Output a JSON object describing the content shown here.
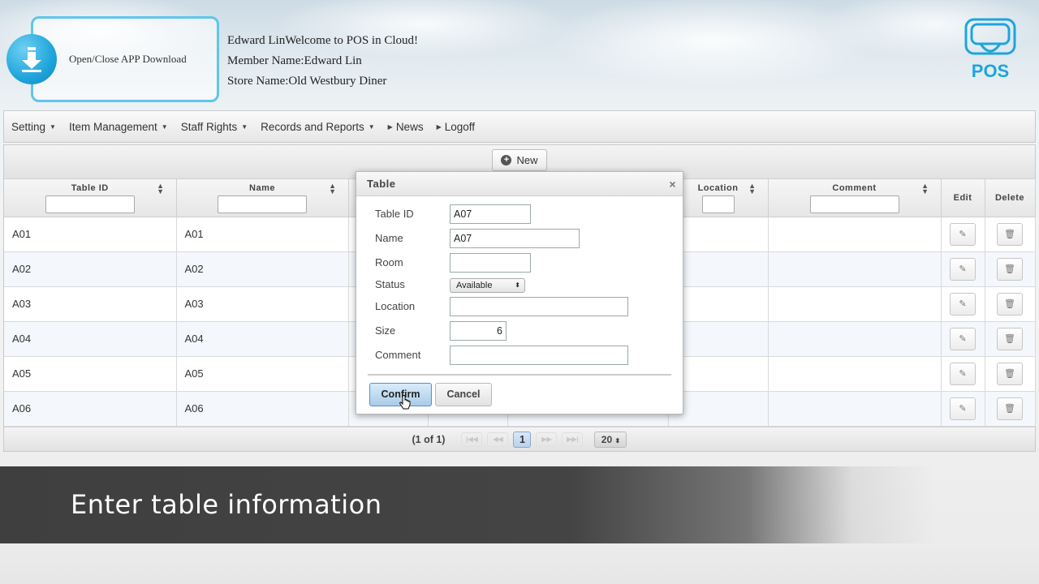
{
  "header": {
    "app_download_label": "Open/Close APP Download",
    "welcome_line": "Edward LinWelcome to POS in Cloud!",
    "member_line": "Member Name:Edward Lin",
    "store_line": "Store Name:Old Westbury Diner",
    "logo_text": "POS",
    "accent_color": "#1ea5dc"
  },
  "nav": {
    "items": [
      {
        "label": "Setting",
        "type": "dropdown"
      },
      {
        "label": "Item Management",
        "type": "dropdown"
      },
      {
        "label": "Staff Rights",
        "type": "dropdown"
      },
      {
        "label": "Records and Reports",
        "type": "dropdown"
      },
      {
        "label": "News",
        "type": "link"
      },
      {
        "label": "Logoff",
        "type": "link"
      }
    ]
  },
  "toolbar": {
    "new_label": "New"
  },
  "grid": {
    "columns": [
      "Table ID",
      "Name",
      "Location",
      "Comment",
      "Edit",
      "Delete"
    ],
    "rows": [
      {
        "table_id": "A01",
        "name": "A01"
      },
      {
        "table_id": "A02",
        "name": "A02"
      },
      {
        "table_id": "A03",
        "name": "A03"
      },
      {
        "table_id": "A04",
        "name": "A04"
      },
      {
        "table_id": "A05",
        "name": "A05"
      },
      {
        "table_id": "A06",
        "name": "A06"
      }
    ]
  },
  "pager": {
    "summary": "(1 of 1)",
    "current_page": "1",
    "page_size": "20"
  },
  "dialog": {
    "title": "Table",
    "close_glyph": "×",
    "fields": {
      "table_id": {
        "label": "Table ID",
        "value": "A07"
      },
      "name": {
        "label": "Name",
        "value": "A07"
      },
      "room": {
        "label": "Room",
        "value": ""
      },
      "status": {
        "label": "Status",
        "value": "Available"
      },
      "location": {
        "label": "Location",
        "value": ""
      },
      "size": {
        "label": "Size",
        "value": "6"
      },
      "comment": {
        "label": "Comment",
        "value": ""
      }
    },
    "confirm_label": "Confirm",
    "cancel_label": "Cancel"
  },
  "caption": {
    "text": "Enter table information"
  }
}
